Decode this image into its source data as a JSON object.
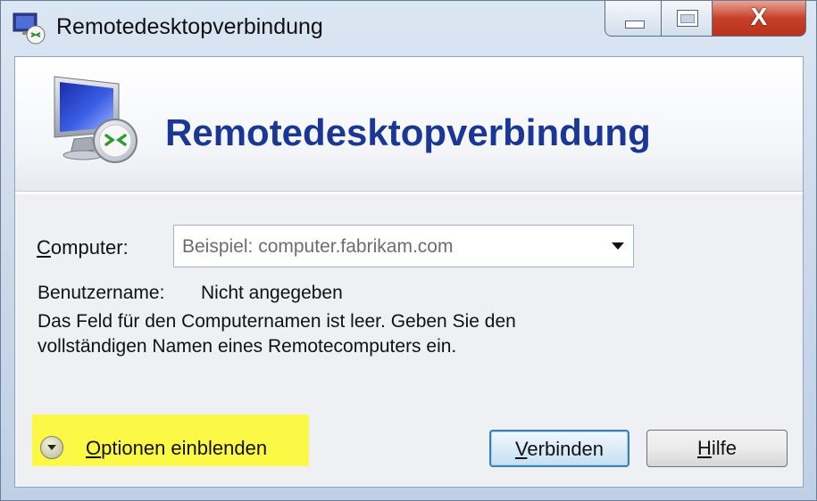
{
  "window": {
    "title": "Remotedesktopverbindung",
    "close_glyph": "X",
    "icons": {
      "app": "remote-desktop-app-icon",
      "banner": "monitor-remote-icon",
      "options": "chevron-down-circle-icon",
      "dropdown": "dropdown-arrow-icon"
    }
  },
  "banner": {
    "title": "Remotedesktopverbindung"
  },
  "form": {
    "computer_label_mnemonic": "C",
    "computer_label_rest": "omputer:",
    "computer_placeholder": "Beispiel: computer.fabrikam.com",
    "username_label": "Benutzername:",
    "username_value": "Nicht angegeben",
    "info_line1": "Das Feld für den Computernamen ist leer. Geben Sie den",
    "info_line2": "vollständigen Namen eines Remotecomputers ein."
  },
  "footer": {
    "options_mnemonic": "O",
    "options_rest": "ptionen einblenden",
    "connect_mnemonic": "V",
    "connect_rest": "erbinden",
    "help_mnemonic": "H",
    "help_rest": "ilfe"
  },
  "colors": {
    "banner_title": "#1b3795",
    "highlight": "#fbf946",
    "close_button": "#c8402a"
  }
}
